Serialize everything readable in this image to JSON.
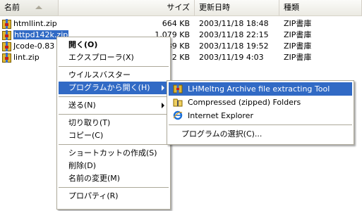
{
  "header": {
    "name": "名前",
    "size": "サイズ",
    "modified": "更新日時",
    "type": "種類"
  },
  "files": [
    {
      "name": "htmllint.zip",
      "size": "664 KB",
      "modified": "2003/11/18 18:48",
      "type": "ZIP書庫"
    },
    {
      "name": "httpd142k.zip",
      "size": "1,079 KB",
      "modified": "2003/11/18 22:15",
      "type": "ZIP書庫"
    },
    {
      "name": "Jcode-0.83",
      "size": "39 KB",
      "modified": "2003/11/18 19:52",
      "type": "ZIP書庫"
    },
    {
      "name": "lint.zip",
      "size": "2 KB",
      "modified": "2003/11/19 4:03",
      "type": "ZIP書庫"
    }
  ],
  "context_menu": {
    "open": "開く(O)",
    "explorer": "エクスプローラ(X)",
    "virus": "ウイルスバスター",
    "open_with": "プログラムから開く(H)",
    "send_to": "送る(N)",
    "cut": "切り取り(T)",
    "copy": "コピー(C)",
    "create_shortcut": "ショートカットの作成(S)",
    "delete": "削除(D)",
    "rename": "名前の変更(M)",
    "properties": "プロパティ(R)"
  },
  "submenu": {
    "lhmelting": "LHMeltng Archive file extracting Tool",
    "compressed": "Compressed (zipped) Folders",
    "ie": "Internet Explorer",
    "choose": "プログラムの選択(C)..."
  },
  "colors": {
    "highlight": "#316ac5",
    "menu_border": "#aca899"
  }
}
